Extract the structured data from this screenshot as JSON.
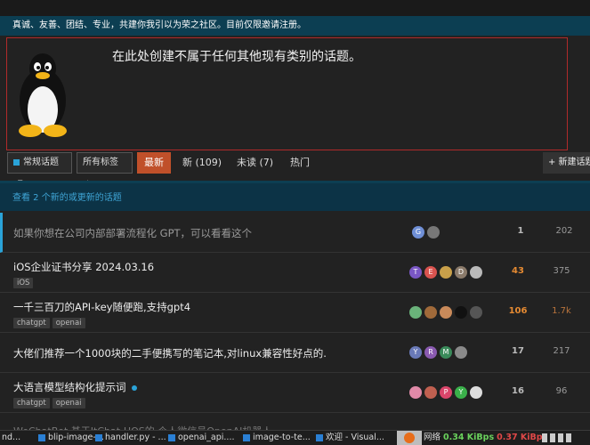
{
  "banner": "真诚、友善、团结、专业，共建你我引以为荣之社区。目前仅限邀请注册。",
  "welcome": {
    "text": "在此处创建不属于任何其他现有类别的话题。"
  },
  "nav": {
    "category": "常规话题",
    "tags": "所有标签",
    "tabs": {
      "latest": "最新",
      "new": "新 (109)",
      "unread": "未读 (7)",
      "top": "热门"
    },
    "new_topic": "+ 新建话题"
  },
  "new_topics_notice": "查看 2 个新的或更新的话题",
  "topics": [
    {
      "title": "如果你想在公司内部部署流程化 GPT，可以看看这个",
      "tags": [],
      "avatars": [
        "G",
        ""
      ],
      "replies": "1",
      "views": "202"
    },
    {
      "title": "iOS企业证书分享 2024.03.16",
      "tags": [
        "iOS"
      ],
      "avatars": [
        "T",
        "E",
        "",
        "D",
        ""
      ],
      "replies": "43",
      "views": "375"
    },
    {
      "title": "一千三百刀的API-key随便跑,支持gpt4",
      "tags": [
        "chatgpt",
        "openai"
      ],
      "avatars": [
        "",
        "",
        "",
        "",
        ""
      ],
      "replies": "106",
      "views": "1.7k"
    },
    {
      "title": "大佬们推荐一个1000块的二手便携写的笔记本,对linux兼容性好点的.",
      "tags": [],
      "avatars": [
        "Y",
        "R",
        "M",
        ""
      ],
      "replies": "17",
      "views": "217"
    },
    {
      "title": "大语言模型结构化提示词",
      "tags": [
        "chatgpt",
        "openai"
      ],
      "avatars": [
        "",
        "",
        "P",
        "Y",
        ""
      ],
      "replies": "16",
      "views": "96"
    }
  ],
  "partial_title": "WeChatBot 基于ItChat-UOS的 个人微信号OpenAI机器人",
  "taskbar": {
    "items": [
      "nd...",
      "blip-image-...",
      "handler.py - ...",
      "openai_api....",
      "image-to-te...",
      "欢迎 - Visual..."
    ],
    "net_label": "网络",
    "down": "0.34 KiBps",
    "up": "0.37 KiBps"
  },
  "colors": {
    "accent": "#c0502a",
    "banner": "#0c3e52",
    "link": "#3fa5d6",
    "hot": "#e58a32"
  }
}
